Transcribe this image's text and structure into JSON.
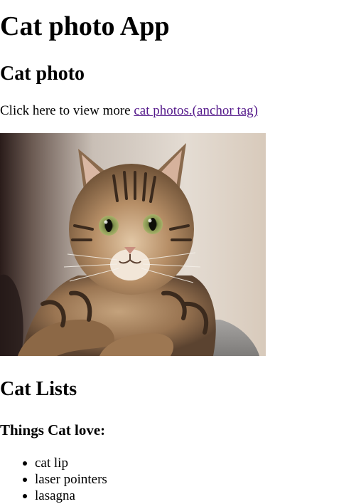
{
  "header": {
    "title": "Cat photo App"
  },
  "photo_section": {
    "heading": "Cat photo",
    "intro_text": "Click here to view more ",
    "link_text": "cat photos.(anchor tag)",
    "image_alt": "A cute orange cat lying on its back."
  },
  "lists_section": {
    "heading": "Cat Lists",
    "subheading": "Things Cat love:",
    "items": [
      {
        "label": "cat lip"
      },
      {
        "label": "laser pointers"
      },
      {
        "label": "lasagna"
      }
    ]
  },
  "colors": {
    "link": "#551a8b",
    "text": "#000000",
    "background": "#ffffff"
  },
  "icons": {
    "bullet": "bullet-icon"
  }
}
